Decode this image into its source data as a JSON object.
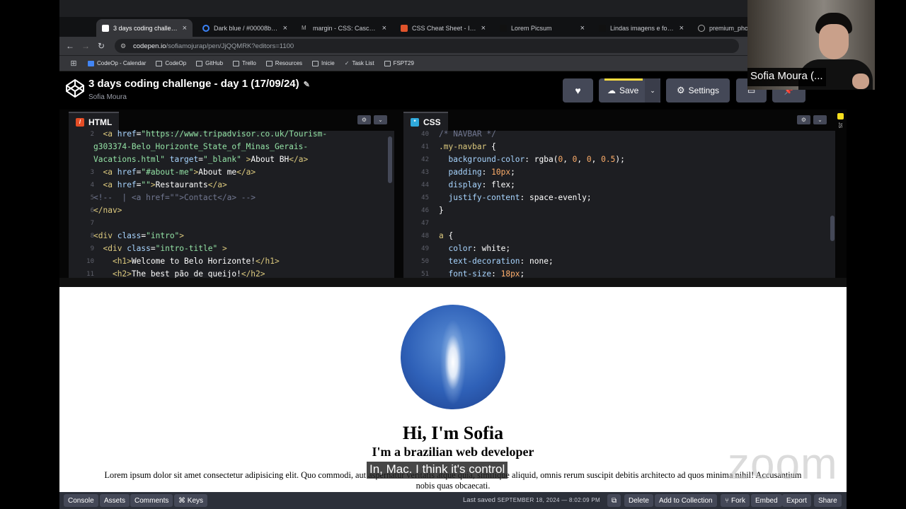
{
  "browser": {
    "tabs": [
      {
        "label": "3 days coding challenge -",
        "active": true,
        "favicon_color": "#ffffff"
      },
      {
        "label": "Dark blue / #00008b hex",
        "active": false,
        "favicon_color": "#3b82f6"
      },
      {
        "label": "margin - CSS: Cascading",
        "active": false,
        "favicon_color": "#aaaaaa"
      },
      {
        "label": "CSS Cheat Sheet - Intera",
        "active": false,
        "favicon_color": "#e0532b"
      },
      {
        "label": "Lorem Picsum",
        "active": false,
        "favicon_color": "#111111"
      },
      {
        "label": "Lindas imagens e fotos g",
        "active": false,
        "favicon_color": "#111111"
      },
      {
        "label": "premium_photo",
        "active": false,
        "favicon_color": "#aaaaaa"
      }
    ],
    "url_host": "codepen.io",
    "url_path": "/sofiamojurap/pen/JjQQMRK?editors=1100",
    "bookmarks": [
      "CodeOp - Calendar",
      "CodeOp",
      "GitHub",
      "Trello",
      "Resources",
      "Inicie",
      "Task List",
      "FSPT29"
    ]
  },
  "header": {
    "title": "3 days coding challenge - day 1 (17/09/24)",
    "author": "Sofia Moura",
    "save_label": "Save",
    "settings_label": "Settings"
  },
  "html_editor": {
    "label": "HTML",
    "line_numbers": [
      "2",
      "",
      "",
      "3",
      "4",
      "5",
      "6",
      "7",
      "8",
      "9",
      "10",
      "11"
    ]
  },
  "css_editor": {
    "label": "CSS",
    "line_numbers": [
      "40",
      "41",
      "42",
      "43",
      "44",
      "45",
      "46",
      "47",
      "48",
      "49",
      "50",
      "51"
    ]
  },
  "preview": {
    "heading": "Hi, I'm Sofia",
    "subheading": "I'm a brazilian web developer",
    "paragraph": "Lorem ipsum dolor sit amet consectetur adipisicing elit. Quo commodi, aut aspernatur veritatis atque quia, similique aliquid, omnis rerum suscipit debitis architecto ad quos minima nihil! Accusantium nobis quas obcaecati.",
    "caption": "In, Mac. I think it's control",
    "watermark": "zoom"
  },
  "footer": {
    "console": "Console",
    "assets": "Assets",
    "comments": "Comments",
    "keys": "⌘ Keys",
    "saved_prefix": "Last saved",
    "saved_time": "SEPTEMBER 18, 2024 — 8:02:09 PM",
    "delete": "Delete",
    "add_collection": "Add to Collection",
    "fork": "Fork",
    "embed": "Embed",
    "export": "Export",
    "share": "Share"
  },
  "zoom_overlay": {
    "participant_name": "Sofia Moura (..."
  },
  "colors": {
    "codepen_black": "#000000",
    "button_gray": "#444857",
    "editor_bg": "#1d1e22",
    "save_accent": "#ffdd40"
  }
}
